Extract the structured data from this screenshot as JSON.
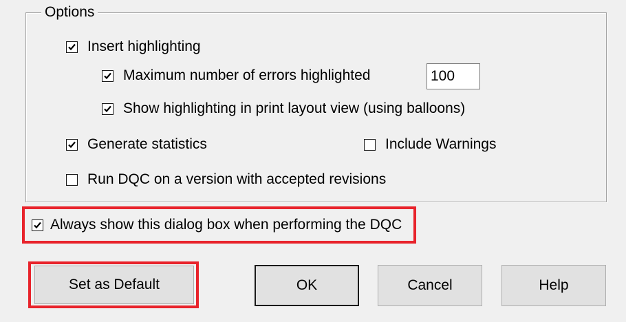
{
  "options_group": {
    "label": "Options",
    "insert_highlighting": {
      "label": "Insert highlighting",
      "checked": true
    },
    "max_errors": {
      "label": "Maximum number of errors highlighted",
      "checked": true,
      "value": "100"
    },
    "show_print_layout": {
      "label": "Show highlighting in print layout view (using balloons)",
      "checked": true
    },
    "generate_statistics": {
      "label": "Generate statistics",
      "checked": true
    },
    "include_warnings": {
      "label": "Include Warnings",
      "checked": false
    },
    "run_dqc_accepted": {
      "label": "Run DQC on a version with accepted revisions",
      "checked": false
    }
  },
  "always_show": {
    "label": "Always show this dialog box when performing the DQC",
    "checked": true
  },
  "buttons": {
    "set_default": "Set as Default",
    "ok": "OK",
    "cancel": "Cancel",
    "help": "Help"
  },
  "highlight_color": "#e8232b"
}
